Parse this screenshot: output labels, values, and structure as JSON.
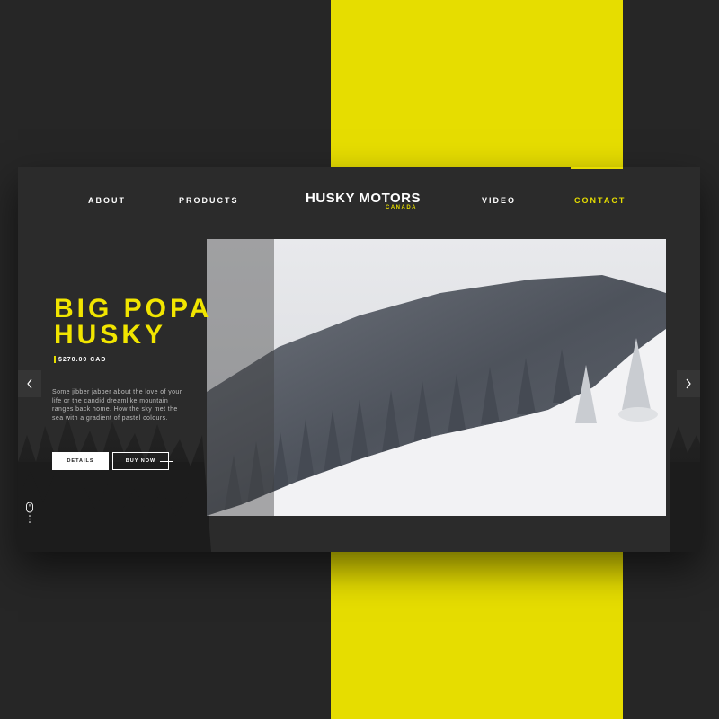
{
  "brand": {
    "name": "HUSKY MOTORS",
    "sub": "CANADA",
    "accent_color": "#e6dd00",
    "background_color": "#262626"
  },
  "nav": {
    "items": [
      {
        "label": "ABOUT"
      },
      {
        "label": "PRODUCTS"
      },
      {
        "label": "VIDEO"
      },
      {
        "label": "CONTACT",
        "active": true
      }
    ]
  },
  "hero": {
    "title_line1": "BIG POPA",
    "title_line2": "HUSKY",
    "price": "$270.00 CAD",
    "description": "Some jibber jabber about the love of your life or the candid dreamlike mountain ranges back home. How the sky met the sea with a gradient of pastel colours.",
    "details_label": "DETAILS",
    "buy_label": "BUY NOW"
  },
  "controls": {
    "prev_icon": "chevron-left-icon",
    "next_icon": "chevron-right-icon",
    "scroll_icon": "mouse-scroll-icon"
  }
}
